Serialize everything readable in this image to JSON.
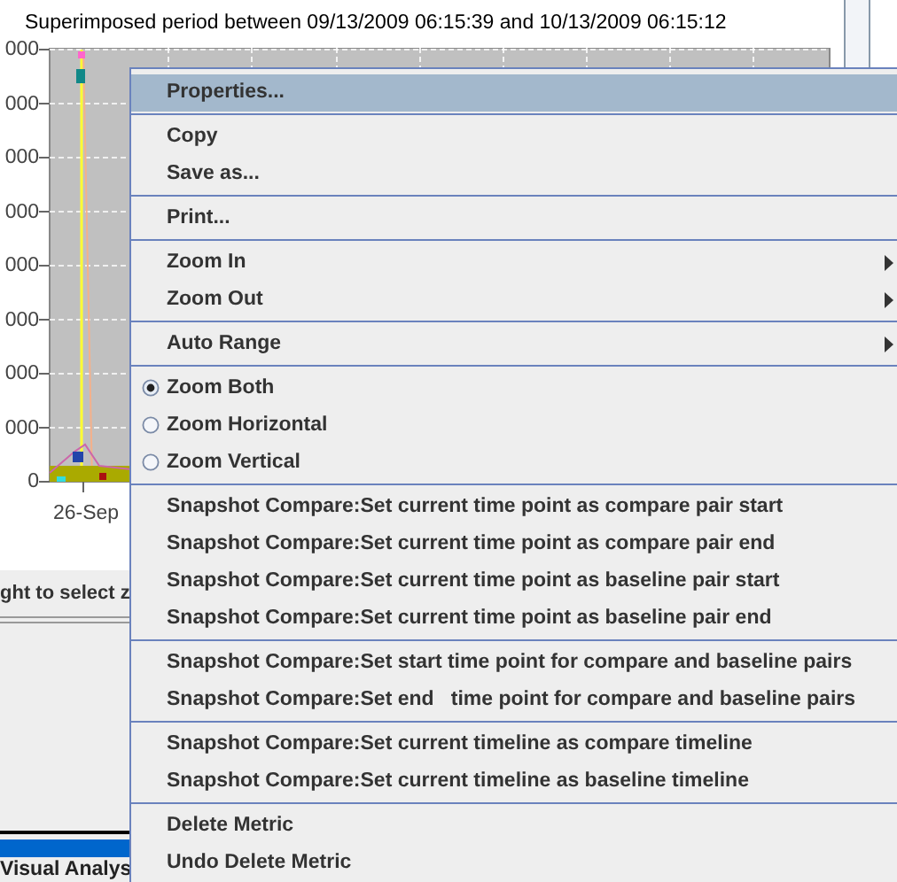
{
  "chart": {
    "subtitle": "Superimposed period between 09/13/2009 06:15:39 and 10/13/2009 06:15:12",
    "y_labels": [
      "000",
      "000",
      "000",
      "000",
      "000",
      "000",
      "000",
      "000",
      "0"
    ],
    "x_labels": [
      "26-Sep"
    ]
  },
  "status_text": "ght to select z",
  "bottom_tab": "Visual Analys",
  "menu": {
    "groups": [
      [
        {
          "kind": "item",
          "label": "Properties...",
          "highlighted": true
        }
      ],
      [
        {
          "kind": "item",
          "label": "Copy",
          "highlighted": false
        },
        {
          "kind": "item",
          "label": "Save as...",
          "highlighted": false
        }
      ],
      [
        {
          "kind": "item",
          "label": "Print...",
          "highlighted": false
        }
      ],
      [
        {
          "kind": "submenu",
          "label": "Zoom In",
          "highlighted": false
        },
        {
          "kind": "submenu",
          "label": "Zoom Out",
          "highlighted": false
        }
      ],
      [
        {
          "kind": "submenu",
          "label": "Auto Range",
          "highlighted": false
        }
      ],
      [
        {
          "kind": "radio",
          "label": "Zoom Both",
          "highlighted": false,
          "selected": true
        },
        {
          "kind": "radio",
          "label": "Zoom Horizontal",
          "highlighted": false,
          "selected": false
        },
        {
          "kind": "radio",
          "label": "Zoom Vertical",
          "highlighted": false,
          "selected": false
        }
      ],
      [
        {
          "kind": "item",
          "label": "Snapshot Compare:Set current time point as compare pair start",
          "highlighted": false
        },
        {
          "kind": "item",
          "label": "Snapshot Compare:Set current time point as compare pair end",
          "highlighted": false
        },
        {
          "kind": "item",
          "label": "Snapshot Compare:Set current time point as baseline pair start",
          "highlighted": false
        },
        {
          "kind": "item",
          "label": "Snapshot Compare:Set current time point as baseline pair end",
          "highlighted": false
        }
      ],
      [
        {
          "kind": "item",
          "label": "Snapshot Compare:Set start time point for compare and baseline pairs",
          "highlighted": false
        },
        {
          "kind": "item",
          "label": "Snapshot Compare:Set end   time point for compare and baseline pairs",
          "highlighted": false
        }
      ],
      [
        {
          "kind": "item",
          "label": "Snapshot Compare:Set current timeline as compare timeline",
          "highlighted": false
        },
        {
          "kind": "item",
          "label": "Snapshot Compare:Set current timeline as baseline timeline",
          "highlighted": false
        }
      ],
      [
        {
          "kind": "item",
          "label": "Delete Metric",
          "highlighted": false
        },
        {
          "kind": "item",
          "label": "Undo Delete Metric",
          "highlighted": false
        }
      ]
    ]
  }
}
